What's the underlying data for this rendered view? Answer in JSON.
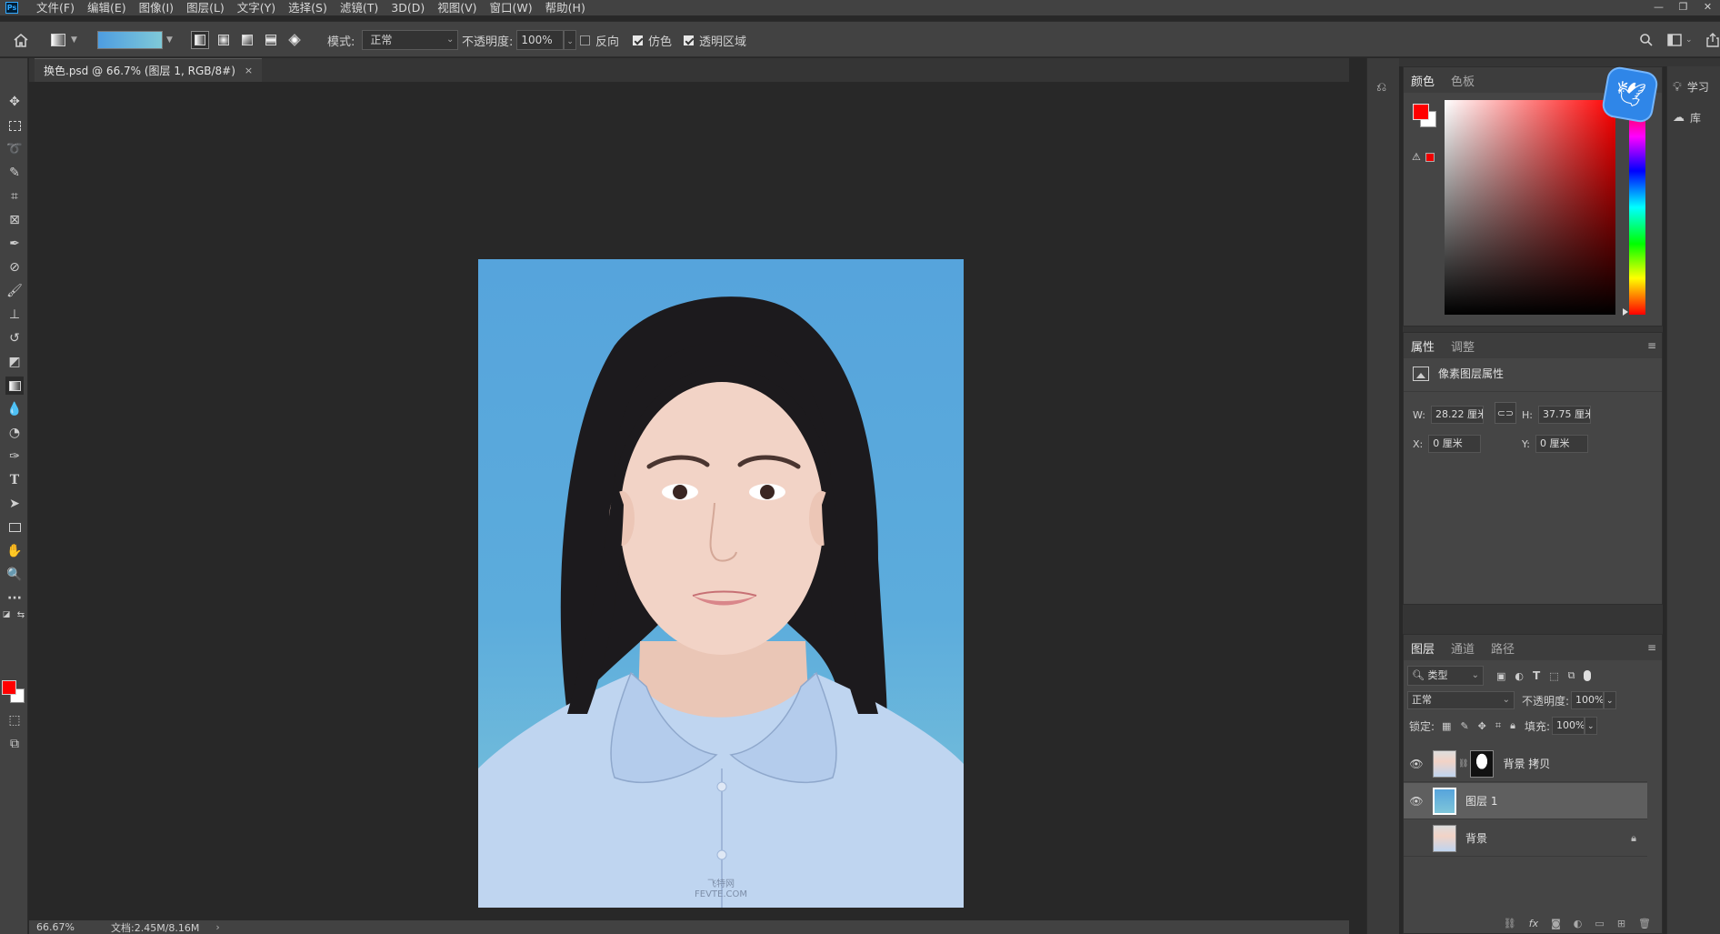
{
  "app": {
    "logo": "Ps"
  },
  "menu": [
    "文件(F)",
    "编辑(E)",
    "图像(I)",
    "图层(L)",
    "文字(Y)",
    "选择(S)",
    "滤镜(T)",
    "3D(D)",
    "视图(V)",
    "窗口(W)",
    "帮助(H)"
  ],
  "window_controls": {
    "minimize": "—",
    "restore": "❐",
    "close": "✕"
  },
  "options": {
    "mode_label": "模式:",
    "mode_value": "正常",
    "opacity_label": "不透明度:",
    "opacity_value": "100%",
    "reverse_label": "反向",
    "reverse_checked": false,
    "dither_label": "仿色",
    "dither_checked": true,
    "transparency_label": "透明区域",
    "transparency_checked": true,
    "gradient_colors": [
      "#4e9de0",
      "#7fc9d8"
    ]
  },
  "document": {
    "tab_title": "换色.psd @ 66.7% (图层 1, RGB/8#)",
    "tab_close": "×",
    "watermark_line1": "飞特网",
    "watermark_line2": "FEVTE.COM"
  },
  "status": {
    "zoom": "66.67%",
    "doc_size": "文档:2.45M/8.16M",
    "arrow": "›"
  },
  "color_panel": {
    "tabs": [
      "颜色",
      "色板"
    ],
    "foreground": "#ff0000",
    "background": "#ffffff",
    "gamut_warning": "⚠"
  },
  "properties_panel": {
    "tabs": [
      "属性",
      "调整"
    ],
    "header": "像素图层属性",
    "w_label": "W:",
    "w_value": "28.22 厘米",
    "h_label": "H:",
    "h_value": "37.75 厘米",
    "x_label": "X:",
    "x_value": "0 厘米",
    "y_label": "Y:",
    "y_value": "0 厘米"
  },
  "layers_panel": {
    "tabs": [
      "图层",
      "通道",
      "路径"
    ],
    "filter_label": "类型",
    "blend_mode": "正常",
    "opacity_label": "不透明度:",
    "opacity_value": "100%",
    "lock_label": "锁定:",
    "fill_label": "填充:",
    "fill_value": "100%",
    "layers": [
      {
        "name": "背景 拷贝",
        "visible": true,
        "selected": false,
        "locked": false
      },
      {
        "name": "图层 1",
        "visible": true,
        "selected": true,
        "locked": false
      },
      {
        "name": "背景",
        "visible": false,
        "selected": false,
        "locked": true
      }
    ],
    "bottom_icons": [
      "link-icon",
      "fx-icon",
      "mask-icon",
      "adjustment-icon",
      "group-icon",
      "new-layer-icon",
      "trash-icon"
    ],
    "fx_text": "fx"
  },
  "side_panel": {
    "learn_label": "学习",
    "library_label": "库"
  }
}
